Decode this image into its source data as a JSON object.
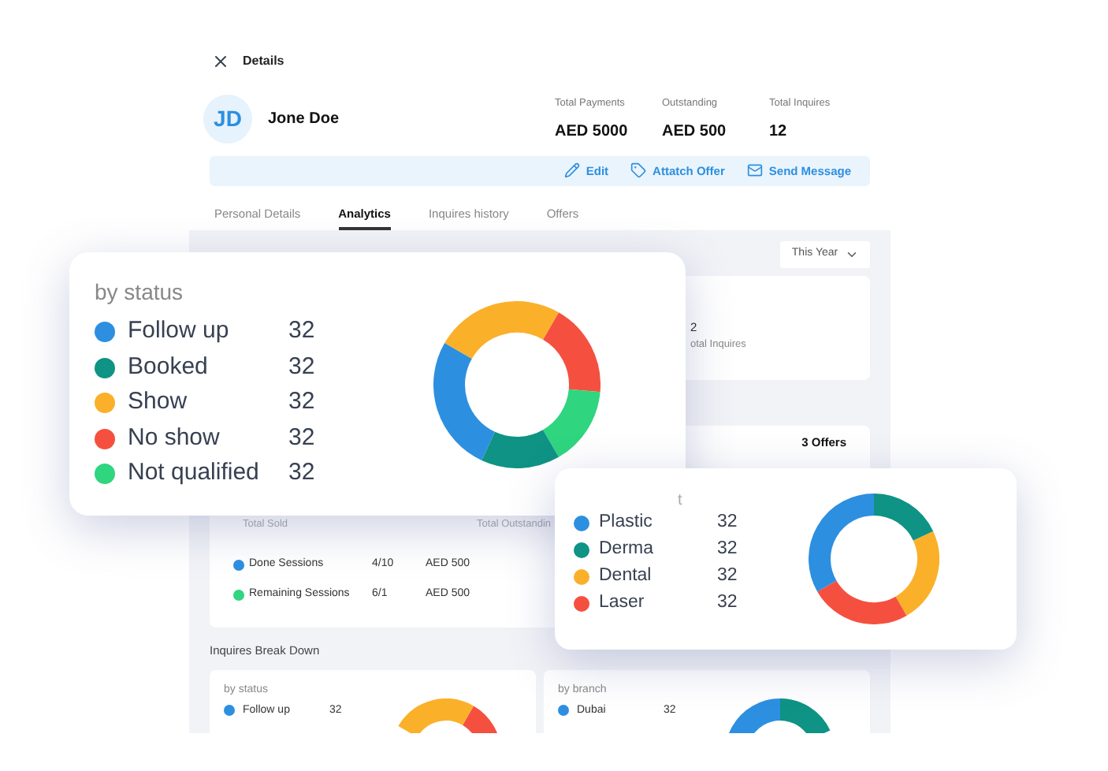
{
  "title": "Details",
  "profile": {
    "initials": "JD",
    "name": "Jone Doe"
  },
  "stats": [
    {
      "label": "Total Payments",
      "value": "AED 5000"
    },
    {
      "label": "Outstanding",
      "value": "AED 500"
    },
    {
      "label": "Total Inquires",
      "value": "12"
    }
  ],
  "actions": [
    {
      "kind": "edit",
      "label": "Edit"
    },
    {
      "kind": "offer",
      "label": "Attatch Offer"
    },
    {
      "kind": "message",
      "label": "Send Message"
    }
  ],
  "tabs": [
    {
      "label": "Personal Details",
      "selected": false
    },
    {
      "label": "Analytics",
      "selected": true
    },
    {
      "label": "Inquires history",
      "selected": false
    },
    {
      "label": "Offers",
      "selected": false
    }
  ],
  "period_dropdown": {
    "value": "This Year"
  },
  "summary_card": {
    "value": "2",
    "label": "otal Inquires"
  },
  "offers_count": "3 Offers",
  "sales": {
    "totals": [
      "Total Sold",
      "Total Outstandin"
    ],
    "sessions": [
      {
        "label": "Done Sessions",
        "count": "4/10",
        "amount": "AED 500",
        "color": "#2d8fe0"
      },
      {
        "label": "Remaining Sessions",
        "count": "6/1",
        "amount": "AED 500",
        "color": "#2fd57f"
      }
    ]
  },
  "breakdown": {
    "title": "Inquires Break Down",
    "cards": [
      {
        "title": "by status",
        "items": [
          {
            "label": "Follow up",
            "value": "32",
            "color": "#2d8fe0"
          }
        ]
      },
      {
        "title": "by branch",
        "items": [
          {
            "label": "Dubai",
            "value": "32",
            "color": "#2d8fe0"
          }
        ]
      }
    ]
  },
  "status_popup": {
    "title": "by status",
    "items": [
      {
        "label": "Follow up",
        "value": "32",
        "color": "#2d8fe0"
      },
      {
        "label": "Booked",
        "value": "32",
        "color": "#0e9384"
      },
      {
        "label": "Show",
        "value": "32",
        "color": "#fbb02a"
      },
      {
        "label": "No show",
        "value": "32",
        "color": "#f5503f"
      },
      {
        "label": "Not qualified",
        "value": "32",
        "color": "#2fd57f"
      }
    ]
  },
  "department_popup": {
    "title": "t",
    "items": [
      {
        "label": "Plastic",
        "value": "32",
        "color": "#2d8fe0"
      },
      {
        "label": "Derma",
        "value": "32",
        "color": "#0e9384"
      },
      {
        "label": "Dental",
        "value": "32",
        "color": "#fbb02a"
      },
      {
        "label": "Laser",
        "value": "32",
        "color": "#f5503f"
      }
    ]
  }
}
